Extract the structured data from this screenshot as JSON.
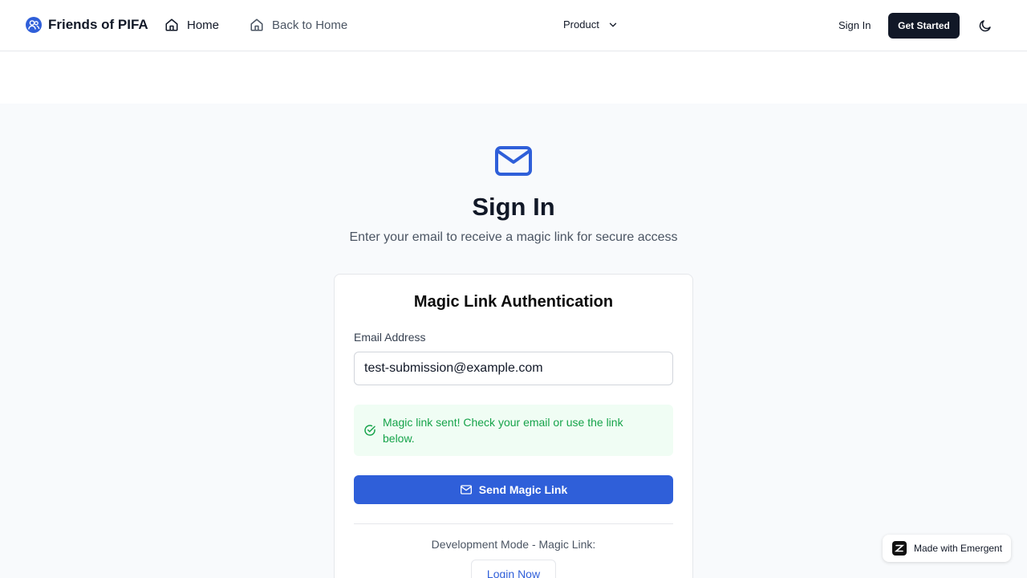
{
  "header": {
    "brand": "Friends of PIFA",
    "nav_home": "Home",
    "nav_back": "Back to Home",
    "nav_product": "Product",
    "sign_in": "Sign In",
    "get_started": "Get Started",
    "theme_icon": "moon-icon"
  },
  "hero": {
    "icon": "mail-icon",
    "title": "Sign In",
    "subtitle": "Enter your email to receive a magic link for secure access"
  },
  "card": {
    "title": "Magic Link Authentication",
    "email_label": "Email Address",
    "email_value": "test-submission@example.com",
    "alert_text": "Magic link sent! Check your email or use the link below.",
    "send_button": "Send Magic Link",
    "dev_label": "Development Mode - Magic Link:",
    "login_button": "Login Now"
  },
  "badge": {
    "text": "Made with Emergent"
  },
  "colors": {
    "primary": "#2f5fd9",
    "success": "#16a34a",
    "success_bg": "#f0fdf4",
    "dark": "#111827"
  }
}
